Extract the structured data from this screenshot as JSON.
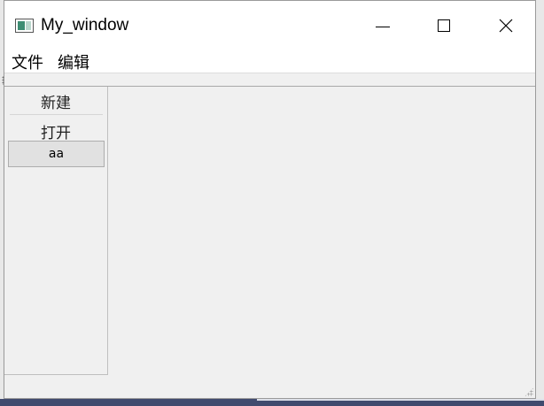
{
  "window": {
    "title": "My_window"
  },
  "menubar": {
    "items": [
      {
        "label": "文件"
      },
      {
        "label": "编辑"
      }
    ]
  },
  "dock": {
    "items": [
      {
        "label": "新建"
      },
      {
        "label": "打开"
      }
    ],
    "button_label": "aa"
  }
}
